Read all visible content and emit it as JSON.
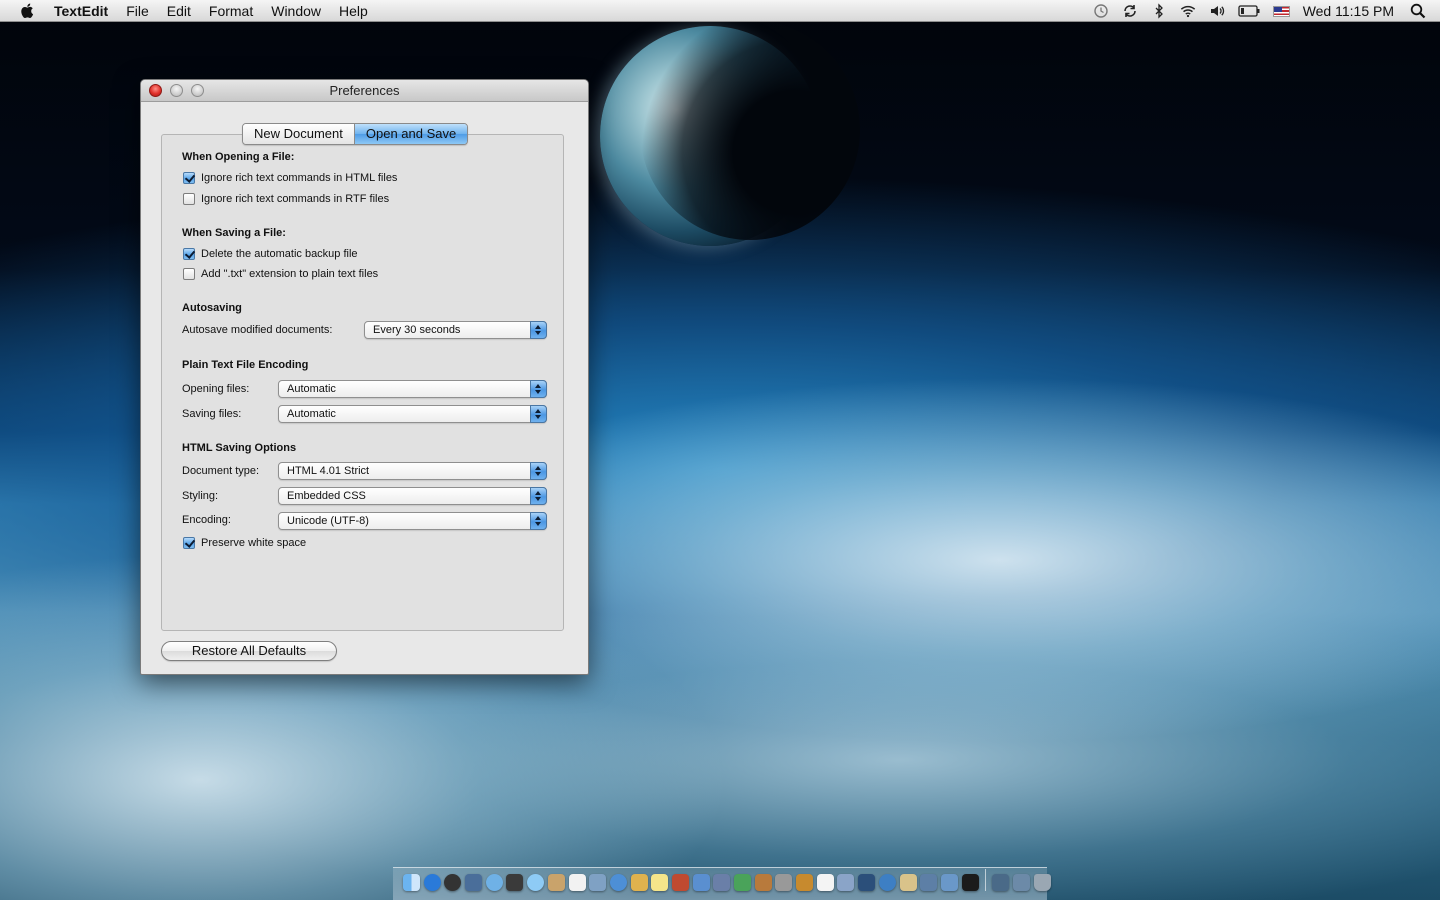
{
  "menubar": {
    "app_name": "TextEdit",
    "menus": [
      "File",
      "Edit",
      "Format",
      "Window",
      "Help"
    ],
    "status_icons": [
      "time-machine-icon",
      "sync-icon",
      "bluetooth-icon",
      "wifi-icon",
      "volume-icon",
      "battery-icon",
      "us-flag-icon"
    ],
    "clock": "Wed 11:15 PM"
  },
  "window": {
    "title": "Preferences",
    "tabs": [
      {
        "label": "New Document",
        "selected": false
      },
      {
        "label": "Open and Save",
        "selected": true
      }
    ],
    "opening": {
      "title": "When Opening a File:",
      "ignore_html": {
        "label": "Ignore rich text commands in HTML files",
        "checked": true
      },
      "ignore_rtf": {
        "label": "Ignore rich text commands in RTF files",
        "checked": false
      }
    },
    "saving": {
      "title": "When Saving a File:",
      "delete_backup": {
        "label": "Delete the automatic backup file",
        "checked": true
      },
      "add_txt": {
        "label": "Add \".txt\" extension to plain text files",
        "checked": false
      }
    },
    "autosaving": {
      "title": "Autosaving",
      "label": "Autosave modified documents:",
      "value": "Every 30 seconds"
    },
    "encoding": {
      "title": "Plain Text File Encoding",
      "opening_label": "Opening files:",
      "opening_value": "Automatic",
      "saving_label": "Saving files:",
      "saving_value": "Automatic"
    },
    "html": {
      "title": "HTML Saving Options",
      "doctype_label": "Document type:",
      "doctype_value": "HTML 4.01 Strict",
      "styling_label": "Styling:",
      "styling_value": "Embedded CSS",
      "encoding_label": "Encoding:",
      "encoding_value": "Unicode (UTF-8)",
      "preserve": {
        "label": "Preserve white space",
        "checked": true
      }
    },
    "restore_label": "Restore All Defaults"
  },
  "colors": {
    "accent": "#5ba6ea",
    "close_button": "#e0302a"
  }
}
